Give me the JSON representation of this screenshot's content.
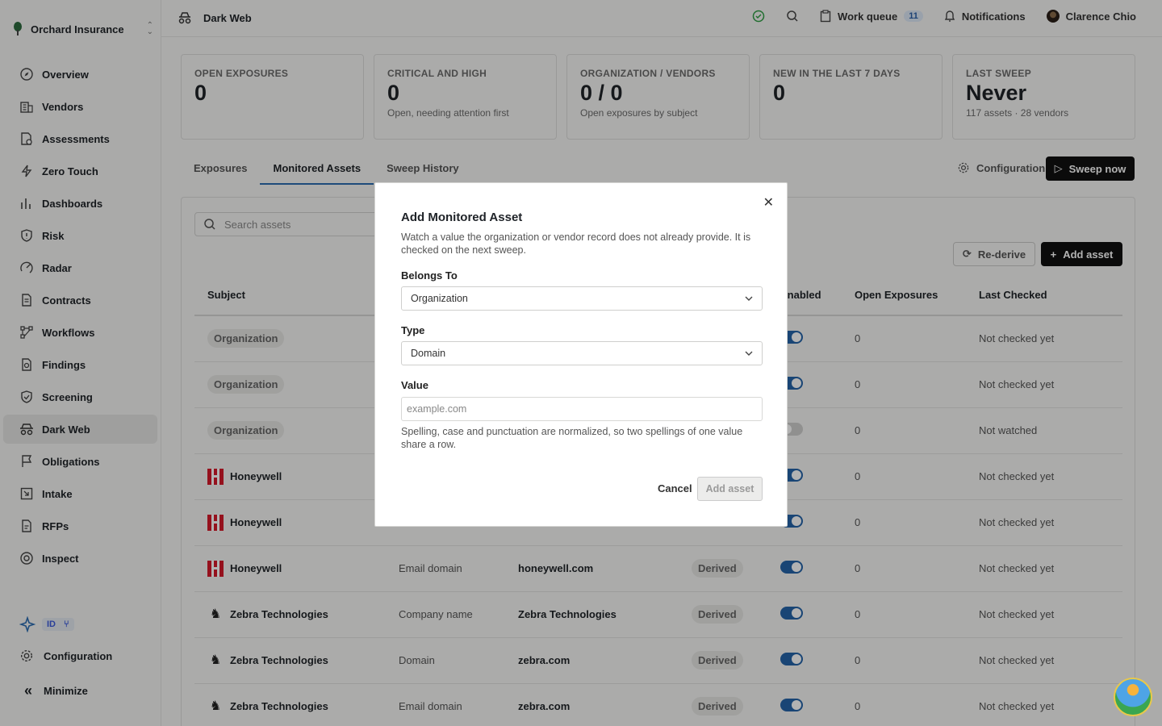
{
  "org": {
    "name": "Orchard Insurance"
  },
  "nav": [
    {
      "label": "Overview",
      "icon": "compass-icon"
    },
    {
      "label": "Vendors",
      "icon": "building-icon"
    },
    {
      "label": "Assessments",
      "icon": "file-check-icon"
    },
    {
      "label": "Zero Touch",
      "icon": "bolt-icon"
    },
    {
      "label": "Dashboards",
      "icon": "bar-chart-icon"
    },
    {
      "label": "Risk",
      "icon": "shield-alert-icon"
    },
    {
      "label": "Radar",
      "icon": "radar-icon"
    },
    {
      "label": "Contracts",
      "icon": "document-icon"
    },
    {
      "label": "Workflows",
      "icon": "workflow-icon"
    },
    {
      "label": "Findings",
      "icon": "search-file-icon"
    },
    {
      "label": "Screening",
      "icon": "shield-check-icon"
    },
    {
      "label": "Dark Web",
      "icon": "spy-icon"
    },
    {
      "label": "Obligations",
      "icon": "flag-icon"
    },
    {
      "label": "Intake",
      "icon": "inbox-icon"
    },
    {
      "label": "RFPs",
      "icon": "file-text-icon"
    },
    {
      "label": "Inspect",
      "icon": "eye-icon"
    }
  ],
  "sidebar_bottom": {
    "tools_badge": "ID",
    "config_label": "Configuration",
    "minimize_label": "Minimize"
  },
  "topbar": {
    "title": "Dark Web",
    "work_queue": "Work queue",
    "work_queue_count": "11",
    "notifications": "Notifications",
    "user": "Clarence Chio"
  },
  "stats": [
    {
      "key": "OPEN EXPOSURES",
      "value": "0",
      "sub": ""
    },
    {
      "key": "CRITICAL AND HIGH",
      "value": "0",
      "sub": "Open, needing attention first"
    },
    {
      "key": "ORGANIZATION / VENDORS",
      "value": "0 / 0",
      "sub": "Open exposures by subject"
    },
    {
      "key": "NEW IN THE LAST 7 DAYS",
      "value": "0",
      "sub": ""
    },
    {
      "key": "LAST SWEEP",
      "value": "Never",
      "sub": "117 assets · 28 vendors"
    }
  ],
  "tabs": [
    "Exposures",
    "Monitored Assets",
    "Sweep History"
  ],
  "actions": {
    "configuration": "Configuration",
    "sweep_now": "Sweep now",
    "rederive": "Re-derive",
    "add_asset": "Add asset",
    "search_placeholder": "Search assets"
  },
  "table": {
    "headers": [
      "Subject",
      "",
      "",
      "",
      "Enabled",
      "Open Exposures",
      "Last Checked"
    ],
    "rows": [
      {
        "subject": "Organization",
        "kind": "chip",
        "type": "",
        "value": "",
        "source": "",
        "enabled": true,
        "exposures": "0",
        "checked": "Not checked yet"
      },
      {
        "subject": "Organization",
        "kind": "chip",
        "type": "",
        "value": "",
        "source": "",
        "enabled": true,
        "exposures": "0",
        "checked": "Not checked yet"
      },
      {
        "subject": "Organization",
        "kind": "chip",
        "type": "",
        "value": "",
        "source": "",
        "enabled": false,
        "exposures": "0",
        "checked": "Not watched"
      },
      {
        "subject": "Honeywell",
        "kind": "honeywell",
        "type": "",
        "value": "",
        "source": "",
        "enabled": true,
        "exposures": "0",
        "checked": "Not checked yet"
      },
      {
        "subject": "Honeywell",
        "kind": "honeywell",
        "type": "",
        "value": "",
        "source": "",
        "enabled": true,
        "exposures": "0",
        "checked": "Not checked yet"
      },
      {
        "subject": "Honeywell",
        "kind": "honeywell",
        "type": "Email domain",
        "value": "honeywell.com",
        "source": "Derived",
        "enabled": true,
        "exposures": "0",
        "checked": "Not checked yet"
      },
      {
        "subject": "Zebra Technologies",
        "kind": "zebra",
        "type": "Company name",
        "value": "Zebra Technologies",
        "source": "Derived",
        "enabled": true,
        "exposures": "0",
        "checked": "Not checked yet"
      },
      {
        "subject": "Zebra Technologies",
        "kind": "zebra",
        "type": "Domain",
        "value": "zebra.com",
        "source": "Derived",
        "enabled": true,
        "exposures": "0",
        "checked": "Not checked yet"
      },
      {
        "subject": "Zebra Technologies",
        "kind": "zebra",
        "type": "Email domain",
        "value": "zebra.com",
        "source": "Derived",
        "enabled": true,
        "exposures": "0",
        "checked": "Not checked yet"
      }
    ]
  },
  "modal": {
    "title": "Add Monitored Asset",
    "description": "Watch a value the organization or vendor record does not already provide. It is checked on the next sweep.",
    "belongs_label": "Belongs To",
    "belongs_value": "Organization",
    "type_label": "Type",
    "type_value": "Domain",
    "value_label": "Value",
    "value_placeholder": "example.com",
    "value_current": "",
    "hint": "Spelling, case and punctuation are normalized, so two spellings of one value share a row.",
    "cancel": "Cancel",
    "submit": "Add asset"
  },
  "colors": {
    "primary": "#2563a8",
    "brand_dark": "#111111"
  }
}
